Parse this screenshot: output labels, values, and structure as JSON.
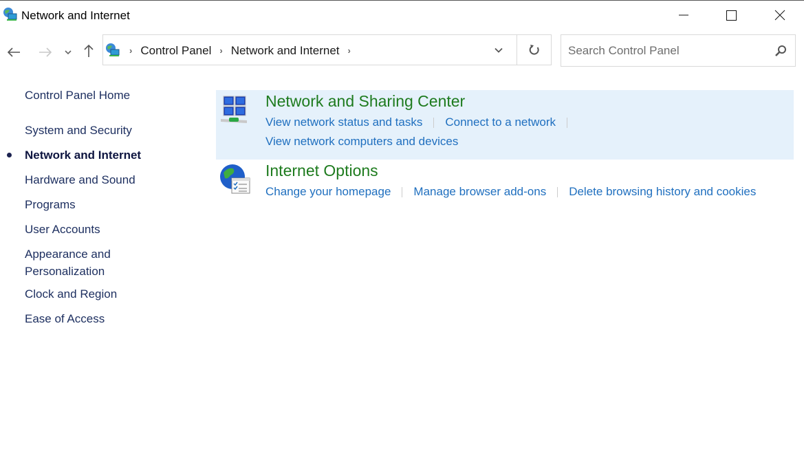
{
  "window": {
    "title": "Network and Internet",
    "icon": "network-internet-icon",
    "controls": {
      "minimize": "minimize-icon",
      "maximize": "maximize-icon",
      "close": "close-icon"
    }
  },
  "navigation": {
    "back": "arrow-left-icon",
    "forward": "arrow-right-icon",
    "recent": "chevron-down-icon",
    "up": "arrow-up-icon",
    "breadcrumb": [
      "Control Panel",
      "Network and Internet"
    ],
    "refresh": "refresh-icon"
  },
  "search": {
    "placeholder": "Search Control Panel",
    "value": ""
  },
  "sidebar": {
    "home": "Control Panel Home",
    "items": [
      {
        "label": "System and Security"
      },
      {
        "label": "Network and Internet",
        "active": true
      },
      {
        "label": "Hardware and Sound"
      },
      {
        "label": "Programs"
      },
      {
        "label": "User Accounts"
      },
      {
        "label": "Appearance and Personalization"
      },
      {
        "label": "Clock and Region"
      },
      {
        "label": "Ease of Access"
      }
    ]
  },
  "categories": [
    {
      "title": "Network and Sharing Center",
      "icon": "network-sharing-icon",
      "highlighted": true,
      "links": [
        "View network status and tasks",
        "Connect to a network",
        "View network computers and devices"
      ]
    },
    {
      "title": "Internet Options",
      "icon": "internet-options-globe-icon",
      "links": [
        "Change your homepage",
        "Manage browser add-ons",
        "Delete browsing history and cookies"
      ]
    }
  ],
  "colors": {
    "category_title": "#1e7b1e",
    "link": "#1f6fbf",
    "highlight": "#e5f1fb",
    "sidebar_text": "#1c2e5f"
  }
}
